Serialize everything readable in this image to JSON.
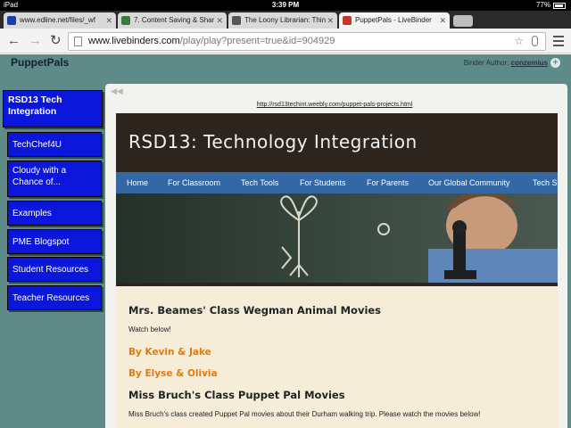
{
  "status_bar": {
    "carrier": "iPad",
    "time": "3:39 PM",
    "battery": "77%"
  },
  "tabs": [
    {
      "label": "www.edline.net/files/_wf",
      "favicon_color": "#1a3fa8",
      "active": false
    },
    {
      "label": "7. Content Saving & Shar",
      "favicon_color": "#3a7a3a",
      "active": false
    },
    {
      "label": "The Loony Librarian: Thin",
      "favicon_color": "#555555",
      "active": false
    },
    {
      "label": "PuppetPals - LiveBinder",
      "favicon_color": "#c0392b",
      "active": true
    }
  ],
  "toolbar": {
    "url_host": "www.livebinders.com",
    "url_path": "/play/play?present=true&id=904929",
    "back_icon": "back-arrow-icon",
    "forward_icon": "forward-arrow-icon",
    "reload_icon": "reload-icon"
  },
  "binder": {
    "title": "PuppetPals",
    "author_label": "Binder Author:",
    "author_name": "conzemius",
    "tabs": [
      "RSD13 Tech Integration",
      "TechChef4U",
      "Cloudy with a Chance of...",
      "Examples",
      "PME Blogspot",
      "Student Resources",
      "Teacher Resources"
    ]
  },
  "content_frame": {
    "url": "http://rsd13techint.weebly.com/puppet-pals-projects.html",
    "site_title": "RSD13: Technology Integration",
    "site_nav": [
      "Home",
      "For Classroom",
      "Tech Tools",
      "For Students",
      "For Parents",
      "Our Global Community",
      "Tech Sh"
    ],
    "heading1": "Mrs. Beames' Class Wegman Animal Movies",
    "watch_text": "Watch below!",
    "credit1": "By Kevin & Jake",
    "credit2": "By Elyse & Olivia",
    "heading2": "Miss Bruch's Class Puppet Pal Movies",
    "paragraph": "Miss Bruch's class created Puppet Pal movies about their Durham walking trip. Please watch the movies below!"
  },
  "colors": {
    "page_bg": "#5e8a88",
    "side_tab": "#0a16d9",
    "site_nav": "#3468a4",
    "accent_orange": "#e07b12"
  }
}
